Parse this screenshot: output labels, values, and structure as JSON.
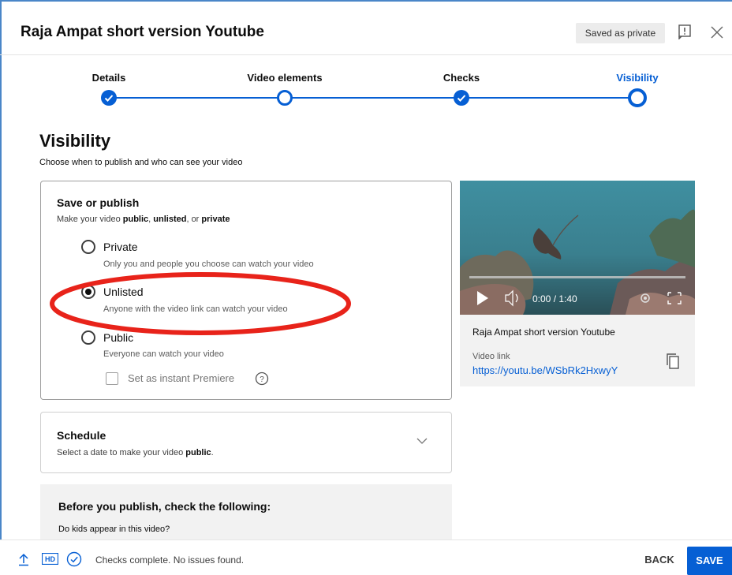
{
  "window": {
    "title": "Raja Ampat short version Youtube",
    "status_badge": "Saved as private"
  },
  "stepper": {
    "steps": [
      {
        "label": "Details",
        "state": "done"
      },
      {
        "label": "Video elements",
        "state": "current-pending"
      },
      {
        "label": "Checks",
        "state": "done"
      },
      {
        "label": "Visibility",
        "state": "active"
      }
    ]
  },
  "visibility": {
    "heading": "Visibility",
    "subheading": "Choose when to publish and who can see your video",
    "save_publish": {
      "heading": "Save or publish",
      "desc_prefix": "Make your video ",
      "desc_public": "public",
      "desc_sep1": ", ",
      "desc_unlisted": "unlisted",
      "desc_sep2": ", or ",
      "desc_private": "private"
    },
    "options": [
      {
        "label": "Private",
        "desc": "Only you and people you choose can watch your video",
        "selected": false
      },
      {
        "label": "Unlisted",
        "desc": "Anyone with the video link can watch your video",
        "selected": true
      },
      {
        "label": "Public",
        "desc": "Everyone can watch your video",
        "selected": false
      }
    ],
    "premiere_label": "Set as instant Premiere",
    "highlight_color": "#e8231a"
  },
  "schedule": {
    "heading": "Schedule",
    "desc_prefix": "Select a date to make your video ",
    "desc_bold": "public",
    "desc_suffix": "."
  },
  "before_publish": {
    "heading": "Before you publish, check the following:",
    "question": "Do kids appear in this video?"
  },
  "video": {
    "time": "0:00 / 1:40",
    "title": "Raja Ampat short version Youtube",
    "link_label": "Video link",
    "link": "https://youtu.be/WSbRk2HxwyY",
    "progress": 0
  },
  "footer": {
    "hd_badge": "HD",
    "status": "Checks complete. No issues found.",
    "back_label": "BACK",
    "save_label": "SAVE"
  },
  "colors": {
    "accent": "#065fd4",
    "frame": "#4a86c8"
  }
}
